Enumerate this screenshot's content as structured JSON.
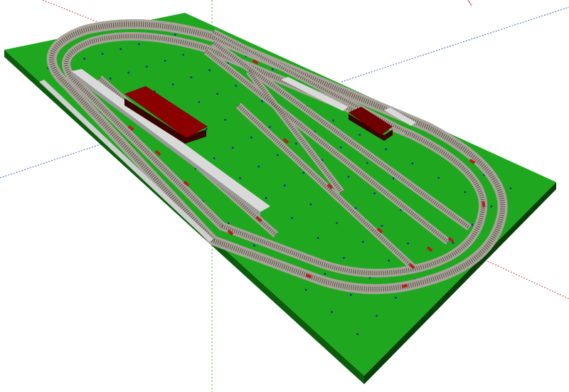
{
  "viewport": {
    "background": "#ffffff",
    "render_mode": "3d-perspective"
  },
  "colors": {
    "baseboard_top": "#1fa81f",
    "baseboard_side": "#0b5c0b",
    "track_ballast": "#a8a39a",
    "track_rail": "#5a5047",
    "track_sleeper": "#7a6a5a",
    "turnout_marker": "#b02020",
    "platform_top": "#d9d9d9",
    "platform_side": "#9a9a9a",
    "building_roof": "#8b0000",
    "building_wall": "#3a0000",
    "axis_red": "#d04040",
    "axis_blue": "#4060c0",
    "axis_green": "#40a040",
    "grid_dot": "#1030a0"
  },
  "scene": {
    "objects": [
      {
        "name": "baseboard",
        "type": "board"
      },
      {
        "name": "outer-oval-track",
        "type": "track-loop"
      },
      {
        "name": "inner-oval-track",
        "type": "track-loop"
      },
      {
        "name": "yard-track-1",
        "type": "siding"
      },
      {
        "name": "yard-track-2",
        "type": "siding"
      },
      {
        "name": "yard-track-3",
        "type": "siding"
      },
      {
        "name": "yard-track-4",
        "type": "siding"
      },
      {
        "name": "yard-track-5",
        "type": "siding"
      },
      {
        "name": "long-platform",
        "type": "platform"
      },
      {
        "name": "right-platform",
        "type": "platform"
      },
      {
        "name": "station-building-large",
        "type": "building"
      },
      {
        "name": "station-building-small",
        "type": "building"
      }
    ]
  }
}
